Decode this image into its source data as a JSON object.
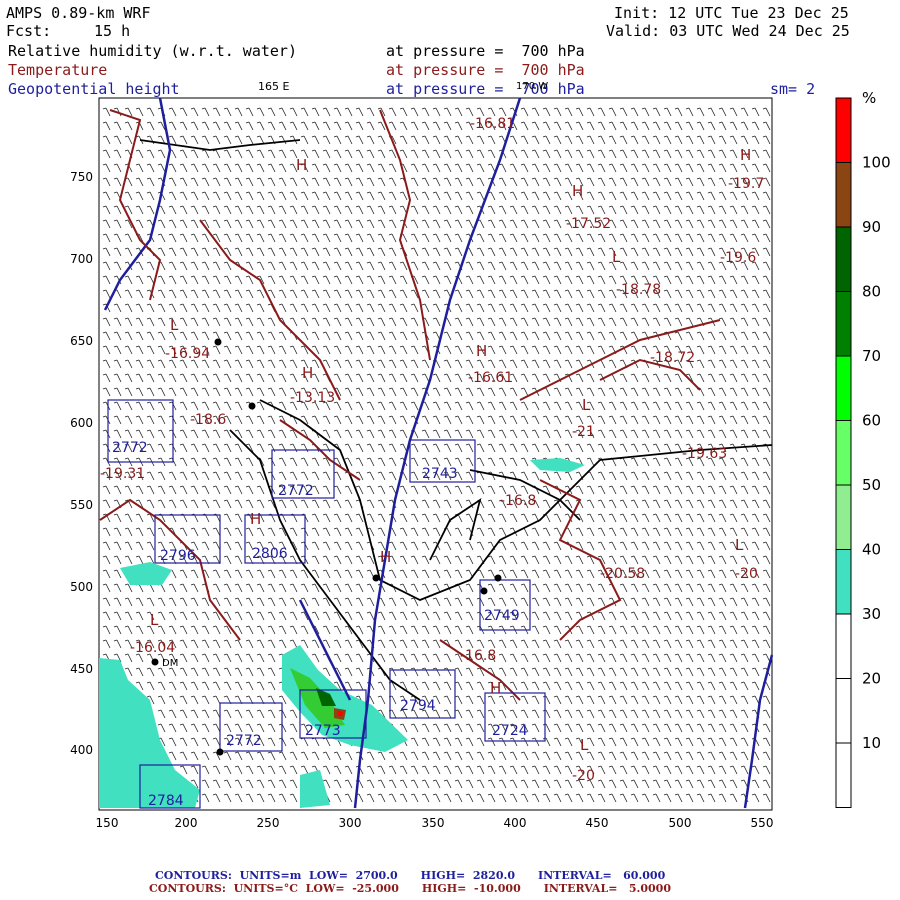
{
  "header": {
    "model": "AMPS 0.89-km WRF",
    "init": "Init: 12 UTC Tue 23 Dec 25",
    "fcst_label": "Fcst:",
    "fcst_value": "15 h",
    "valid": "Valid: 03 UTC Wed 24 Dec 25",
    "rh_label": "Relative humidity (w.r.t. water)",
    "temp_label": "Temperature",
    "geo_label": "Geopotential height",
    "rh_pressure": "at pressure =  700 hPa",
    "temp_pressure": "at pressure =  700 hPa",
    "geo_pressure": "at pressure =  700 hPa",
    "sm": "sm= 2",
    "lon_label": "165 E",
    "lon_label2": "170 W"
  },
  "colorbar": {
    "unit": "%",
    "labels": [
      "100",
      "90",
      "80",
      "70",
      "60",
      "50",
      "40",
      "30",
      "20",
      "10"
    ],
    "colors": [
      "#ff0000",
      "#8b4513",
      "#006400",
      "#008000",
      "#00ff00",
      "#66ff66",
      "#90ee90",
      "#40e0c0",
      "#ffffff",
      "#ffffff",
      "#ffffff"
    ]
  },
  "axes": {
    "x_ticks": [
      "150",
      "200",
      "250",
      "300",
      "350",
      "400",
      "450",
      "500",
      "550"
    ],
    "y_ticks": [
      "750",
      "700",
      "650",
      "600",
      "550",
      "500",
      "450",
      "400"
    ]
  },
  "map_labels": {
    "highs": [
      "H",
      "H",
      "H",
      "H",
      "H",
      "H",
      "H",
      "H"
    ],
    "lows": [
      "L",
      "L",
      "L",
      "L",
      "L",
      "L"
    ],
    "temp_values": [
      "-16.81",
      "-17.52",
      "-19.7",
      "-18.78",
      "-18.72",
      "-16.61",
      "-21",
      "-19.63",
      "-20.58",
      "-20",
      "-19.6",
      "-16.8",
      "-13.13",
      "-18.6",
      "-19.31",
      "-16.04",
      "-20",
      "-16.94",
      "-16.8"
    ],
    "height_values": [
      "2743",
      "2794",
      "2749",
      "2724",
      "2796",
      "2772",
      "2773",
      "2784",
      "2806",
      "2772",
      "2772"
    ],
    "station": "DM"
  },
  "footer": {
    "line1": {
      "prefix": "CONTOURS:",
      "units": "UNITS=m",
      "low": "LOW=  2700.0",
      "high": "HIGH=  2820.0",
      "interval": "INTERVAL=   60.000"
    },
    "line2": {
      "prefix": "CONTOURS:",
      "units": "UNITS=°C",
      "low": "LOW=  -25.000",
      "high": "HIGH=  -10.000",
      "interval": "INTERVAL=   5.0000"
    }
  },
  "colors": {
    "rh_green": "#33cc66",
    "temp_red": "#8b1a1a",
    "height_blue": "#1f1f9e",
    "coast_black": "#000000"
  }
}
